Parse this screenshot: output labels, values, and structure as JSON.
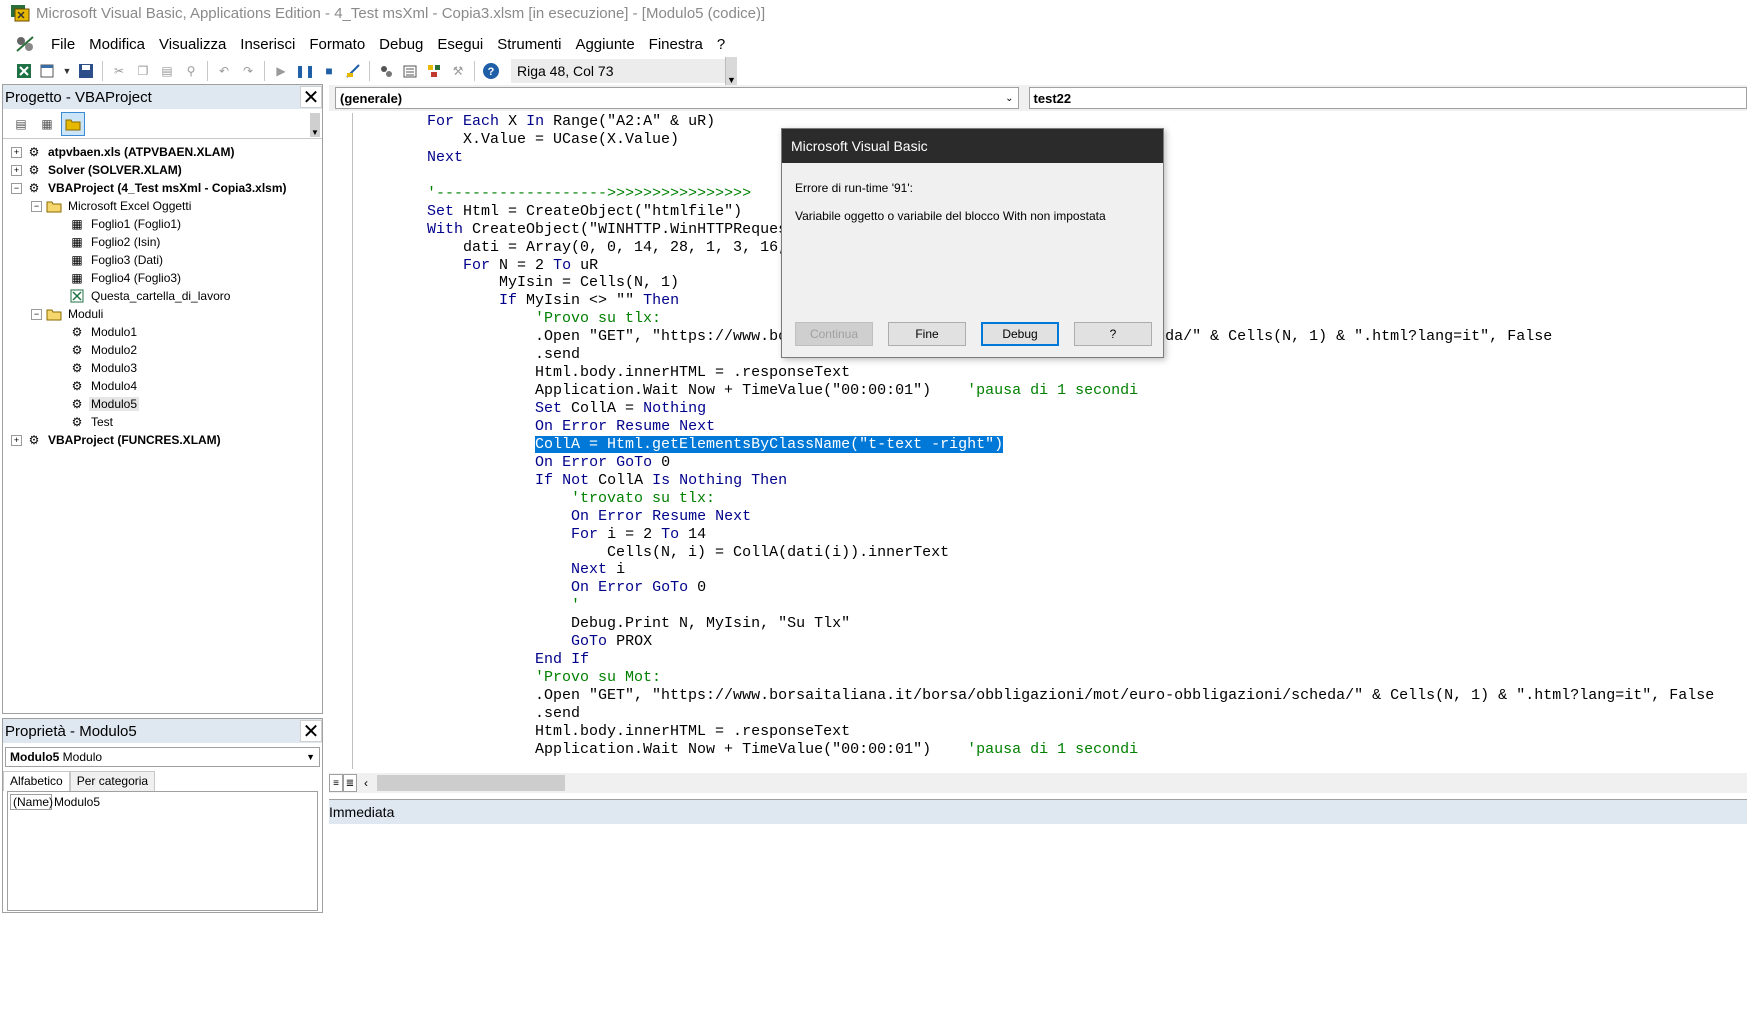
{
  "window": {
    "title": "Microsoft Visual Basic, Applications Edition - 4_Test msXml - Copia3.xlsm [in esecuzione] - [Modulo5 (codice)]"
  },
  "menu": [
    "File",
    "Modifica",
    "Visualizza",
    "Inserisci",
    "Formato",
    "Debug",
    "Esegui",
    "Strumenti",
    "Aggiunte",
    "Finestra",
    "?"
  ],
  "toolbar": {
    "position": "Riga 48, Col 73"
  },
  "project": {
    "title": "Progetto - VBAProject",
    "tree": [
      {
        "label": "atpvbaen.xls (ATPVBAEN.XLAM)",
        "expander": "+"
      },
      {
        "label": "Solver (SOLVER.XLAM)",
        "expander": "+"
      },
      {
        "label": "VBAProject (4_Test msXml - Copia3.xlsm)",
        "expander": "−"
      },
      {
        "label": "Microsoft Excel Oggetti",
        "expander": "−"
      },
      {
        "label": "Foglio1 (Foglio1)"
      },
      {
        "label": "Foglio2 (Isin)"
      },
      {
        "label": "Foglio3 (Dati)"
      },
      {
        "label": "Foglio4 (Foglio3)"
      },
      {
        "label": "Questa_cartella_di_lavoro"
      },
      {
        "label": "Moduli",
        "expander": "−"
      },
      {
        "label": "Modulo1"
      },
      {
        "label": "Modulo2"
      },
      {
        "label": "Modulo3"
      },
      {
        "label": "Modulo4"
      },
      {
        "label": "Modulo5"
      },
      {
        "label": "Test"
      },
      {
        "label": "VBAProject (FUNCRES.XLAM)",
        "expander": "+"
      }
    ]
  },
  "properties": {
    "title": "Proprietà - Modulo5",
    "selector_name": "Modulo5",
    "selector_type": "Modulo",
    "tabs": [
      "Alfabetico",
      "Per categoria"
    ],
    "prop_name": "(Name)",
    "prop_value": "Modulo5"
  },
  "code": {
    "object_combo": "(generale)",
    "proc_combo": "test22",
    "lines": [
      "        For Each X In Range(\"A2:A\" & uR)",
      "            X.Value = UCase(X.Value)",
      "        Next",
      "",
      "        '------------------->>>>>>>>>>>>>>>>",
      "        Set Html = CreateObject(\"htmlfile\")",
      "        With CreateObject(\"WINHTTP.WinHTTPRequest.5.1\")",
      "            dati = Array(0, 0, 14, 28, 1, 3, 16, 7, 9, 12, 10, 24, 22, 20, 18)",
      "            For N = 2 To uR",
      "                MyIsin = Cells(N, 1)",
      "                If MyIsin <> \"\" Then",
      "                    'Provo su tlx:",
      "                    .Open \"GET\", \"https://www.borsaitaliana.it/borsa/obbligazioni/tlx/scheda/\" & Cells(N, 1) & \".html?lang=it\", False",
      "                    .send",
      "                    Html.body.innerHTML = .responseText",
      "                    Application.Wait Now + TimeValue(\"00:00:01\")    'pausa di 1 secondi",
      "                    Set CollA = Nothing",
      "                    On Error Resume Next",
      "                    CollA = Html.getElementsByClassName(\"t-text -right\")",
      "                    On Error GoTo 0",
      "                    If Not CollA Is Nothing Then",
      "                        'trovato su tlx:",
      "                        On Error Resume Next",
      "                        For i = 2 To 14",
      "                            Cells(N, i) = CollA(dati(i)).innerText",
      "                        Next i",
      "                        On Error GoTo 0",
      "                        '",
      "                        Debug.Print N, MyIsin, \"Su Tlx\"",
      "                        GoTo PROX",
      "                    End If",
      "                    'Provo su Mot:",
      "                    .Open \"GET\", \"https://www.borsaitaliana.it/borsa/obbligazioni/mot/euro-obbligazioni/scheda/\" & Cells(N, 1) & \".html?lang=it\", False",
      "                    .send",
      "                    Html.body.innerHTML = .responseText",
      "                    Application.Wait Now + TimeValue(\"00:00:01\")    'pausa di 1 secondi"
    ]
  },
  "immediate": {
    "title": "Immediata"
  },
  "dialog": {
    "title": "Microsoft Visual Basic",
    "error": "Errore di run-time '91':",
    "message": "Variabile oggetto o variabile del blocco With non impostata",
    "buttons": {
      "continua": "Continua",
      "fine": "Fine",
      "debug": "Debug",
      "help": "?"
    }
  },
  "colors": {
    "keyword": "#00008b",
    "comment": "#008000",
    "highlight": "#0078d7",
    "panel_header": "#dfe7f1",
    "dialog_header": "#2b2b2b"
  }
}
